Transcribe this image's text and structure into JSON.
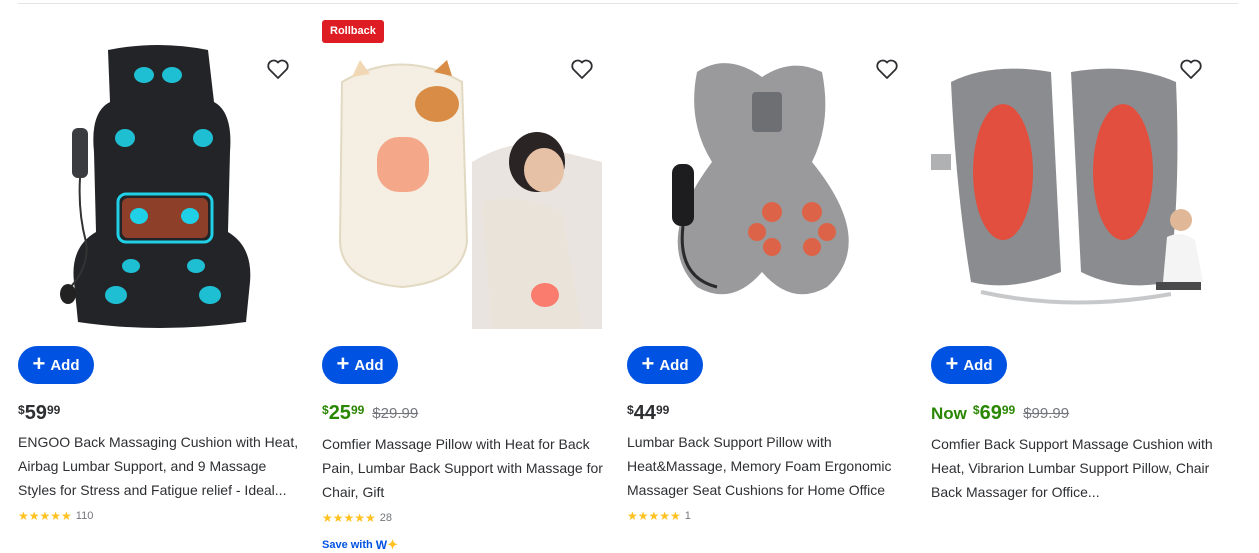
{
  "products": [
    {
      "title": "ENGOO Back Massaging Cushion with Heat, Airbag Lumbar Support, and 9 Massage Styles for Stress and Fatigue relief - Ideal...",
      "price_currency": "$",
      "price_dollars": "59",
      "price_cents": "99",
      "rating_stars": "★★★★★",
      "rating_count": "110",
      "add_label": "Add"
    },
    {
      "badge": "Rollback",
      "title": "Comfier Massage Pillow with Heat for Back Pain, Lumbar Back Support with Massage for Chair, Gift",
      "price_currency": "$",
      "price_dollars": "25",
      "price_cents": "99",
      "was_price": "$29.99",
      "rating_stars": "★★★★★",
      "rating_count": "28",
      "save_with": "Save with",
      "add_label": "Add"
    },
    {
      "title": "Lumbar Back Support Pillow with Heat&Massage, Memory Foam Ergonomic Massager Seat Cushions for Home Office",
      "price_currency": "$",
      "price_dollars": "44",
      "price_cents": "99",
      "rating_stars": "★★★★★",
      "rating_count": "1",
      "add_label": "Add"
    },
    {
      "title": "Comfier Back Support Massage Cushion with Heat, Vibrarion Lumbar Support Pillow, Chair Back Massager for Office...",
      "price_prefix": "Now",
      "price_currency": "$",
      "price_dollars": "69",
      "price_cents": "99",
      "was_price": "$99.99",
      "add_label": "Add"
    }
  ],
  "icons": {
    "favorite": "heart-outline-icon",
    "add": "plus-icon",
    "walmart_plus": "spark-icon"
  },
  "colors": {
    "add_button": "#0053e2",
    "rollback_badge": "#de1c24",
    "sale_price": "#2a8703",
    "star": "#ffc220"
  }
}
